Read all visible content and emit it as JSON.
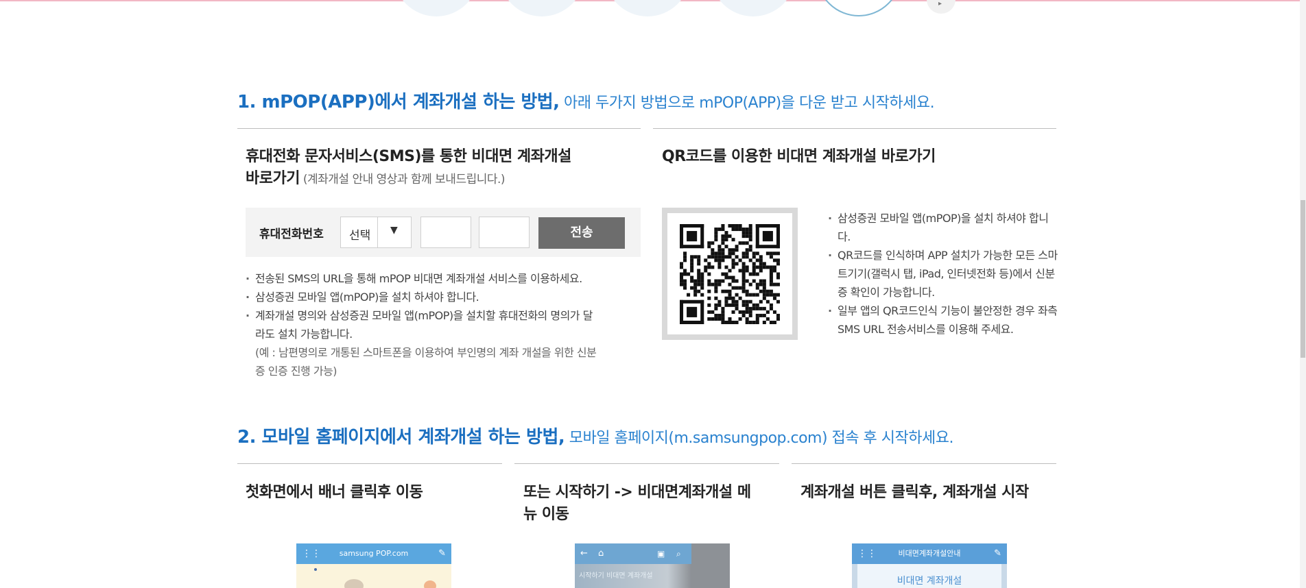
{
  "section1": {
    "title": "1. mPOP(APP)에서 계좌개설 하는 방법,",
    "subtitle": " 아래 두가지 방법으로 mPOP(APP)을 다운 받고 시작하세요.",
    "sms": {
      "title_line1": "휴대전화 문자서비스(SMS)를 통한 비대면 계좌개설",
      "title_line2": "바로가기",
      "title_note": " (계좌개설 안내 영상과 함께 보내드립니다.)",
      "form": {
        "label": "휴대전화번호",
        "select_value": "선택",
        "send_label": "전송"
      },
      "bullets": [
        "전송된 SMS의 URL을 통해 mPOP 비대면 계좌개설 서비스를 이용하세요.",
        "삼성증권 모바일 앱(mPOP)을 설치 하셔야 합니다.",
        "계좌개설 명의와 삼성증권 모바일 앱(mPOP)을 설치할 휴대전화의 명의가 달라도 설치 가능합니다."
      ],
      "note": "(예 : 남편명의로 개통된 스마트폰을 이용하여 부인명의 계좌 개설을 위한 신분증 인증 진행 가능)"
    },
    "qr": {
      "title": "QR코드를 이용한 비대면 계좌개설 바로가기",
      "bullets": [
        "삼성증권 모바일 앱(mPOP)을 설치 하셔야 합니다.",
        "QR코드를 인식하며 APP 설치가 가능한 모든 스마트기기(갤럭시 탭, iPad, 인터넷전화 등)에서 신분증 확인이 가능합니다.",
        "일부 앱의 QR코드인식 기능이 불안정한 경우 좌측 SMS URL 전송서비스를 이용해 주세요."
      ]
    }
  },
  "section2": {
    "title": "2. 모바일 홈페이지에서 계좌개설 하는 방법,",
    "subtitle": " 모바일 홈페이지(m.samsungpop.com) 접속 후 시작하세요.",
    "columns": [
      {
        "title": "첫화면에서 배너 클릭후 이동",
        "preview_bar": "samsung POP.com"
      },
      {
        "title": "또는 시작하기 -> 비대면계좌개설 메뉴 이동",
        "preview_bar": ""
      },
      {
        "title": "계좌개설 버튼 클릭후, 계좌개설 시작",
        "preview_bar": "비대면계좌개설안내",
        "preview_text": "비대면 계좌개설"
      }
    ]
  },
  "colors": {
    "accent": "#1b6fc0",
    "button": "#6d6d6d",
    "formbg": "#f3f3f3"
  }
}
